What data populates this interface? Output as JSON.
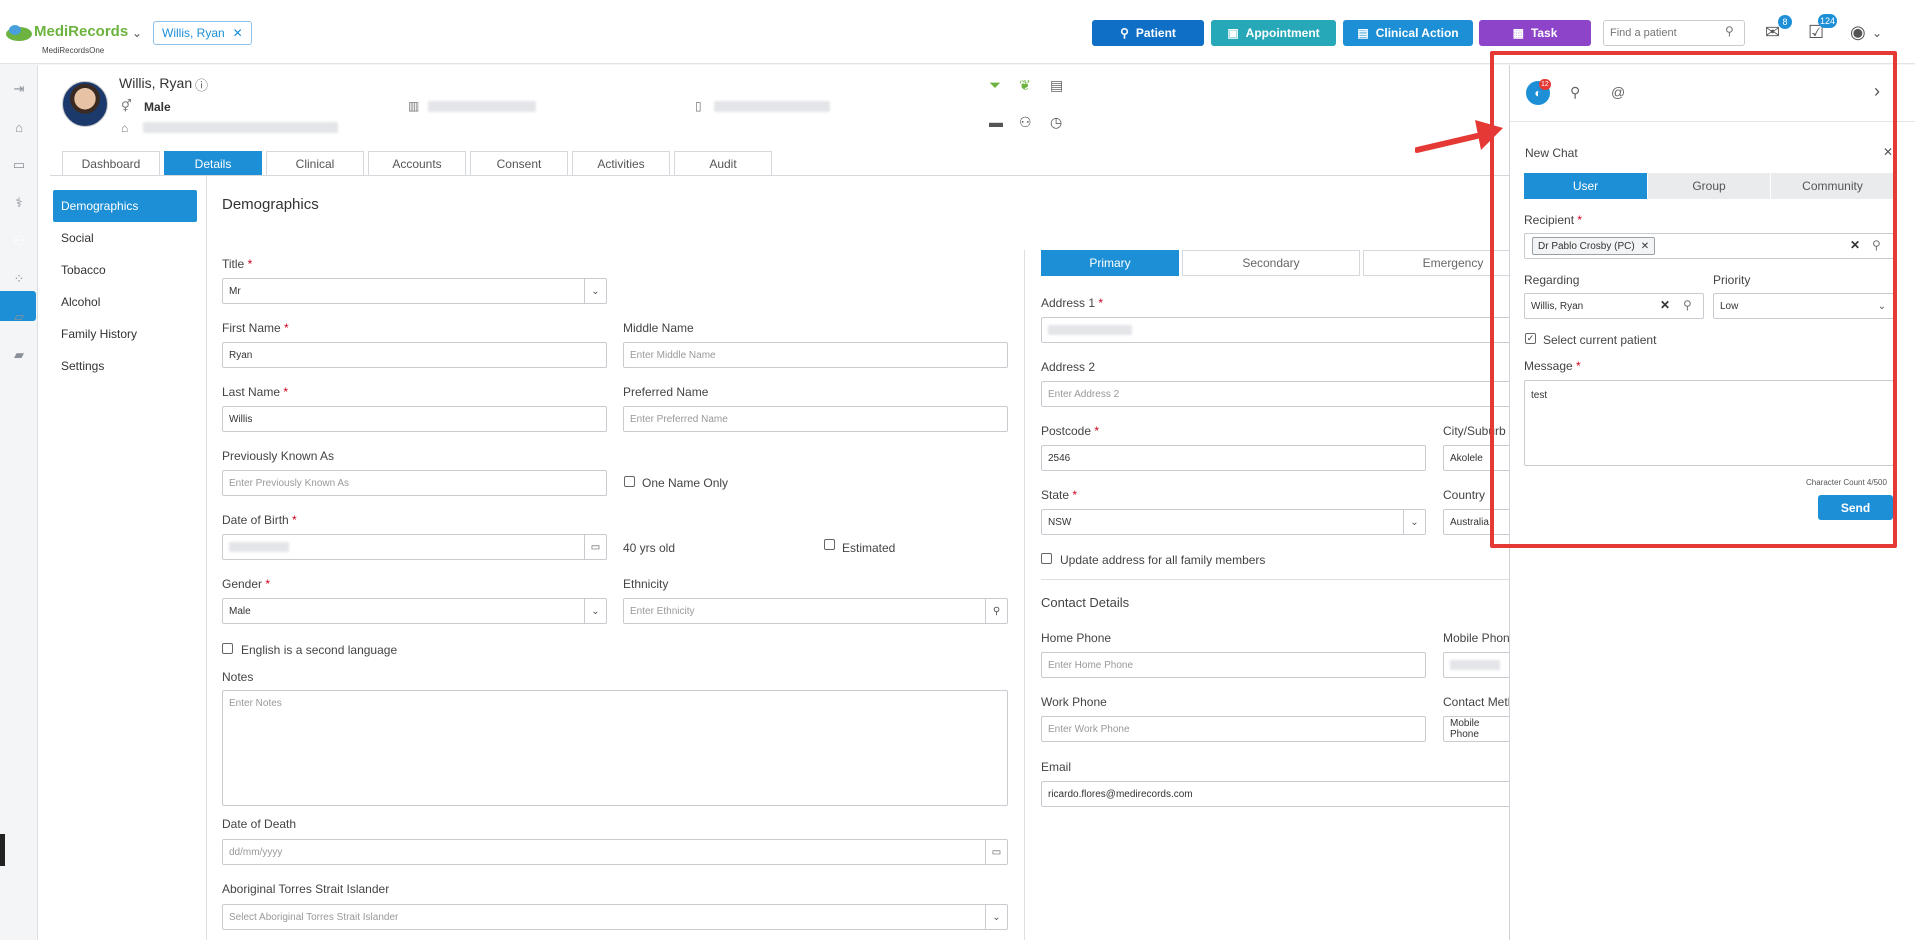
{
  "header": {
    "logo_name": "MediRecords",
    "logo_sub": "MediRecordsOne",
    "patient_chip": "Willis, Ryan",
    "buttons": {
      "patient": "Patient",
      "appointment": "Appointment",
      "clinical_action": "Clinical Action",
      "task": "Task"
    },
    "search_placeholder": "Find a patient",
    "mail_badge": "8",
    "tasks_badge": "124",
    "colors": {
      "patient": "#0f6fc6",
      "appointment": "#26a8b8",
      "clinical_action": "#1d8fd6",
      "task": "#8e44c8"
    }
  },
  "patient": {
    "name": "Willis, Ryan",
    "gender": "Male"
  },
  "tabs": [
    "Dashboard",
    "Details",
    "Clinical",
    "Accounts",
    "Consent",
    "Activities",
    "Audit"
  ],
  "sidenav": [
    "Demographics",
    "Social",
    "Tobacco",
    "Alcohol",
    "Family History",
    "Settings"
  ],
  "form": {
    "section_title": "Demographics",
    "title_label": "Title",
    "title_value": "Mr",
    "first_name_label": "First Name",
    "first_name_value": "Ryan",
    "middle_name_label": "Middle Name",
    "middle_name_ph": "Enter Middle Name",
    "last_name_label": "Last Name",
    "last_name_value": "Willis",
    "preferred_name_label": "Preferred Name",
    "preferred_name_ph": "Enter Preferred Name",
    "prev_known_label": "Previously Known As",
    "prev_known_ph": "Enter Previously Known As",
    "one_name_label": "One Name Only",
    "dob_label": "Date of Birth",
    "age_text": "40 yrs old",
    "estimated_label": "Estimated",
    "gender_label": "Gender",
    "gender_value": "Male",
    "ethnicity_label": "Ethnicity",
    "ethnicity_ph": "Enter Ethnicity",
    "english_second_label": "English is a second language",
    "notes_label": "Notes",
    "notes_ph": "Enter Notes",
    "dod_label": "Date of Death",
    "dod_ph": "dd/mm/yyyy",
    "atsi_label": "Aboriginal Torres Strait Islander",
    "atsi_ph": "Select Aboriginal Torres Strait Islander"
  },
  "address": {
    "tabs": [
      "Primary",
      "Secondary",
      "Emergency"
    ],
    "address1_label": "Address 1",
    "address2_label": "Address 2",
    "address2_ph": "Enter Address 2",
    "postcode_label": "Postcode",
    "postcode_value": "2546",
    "city_label": "City/Suburb",
    "city_value": "Akolele",
    "state_label": "State",
    "state_value": "NSW",
    "country_label": "Country",
    "country_value": "Australia",
    "update_family_label": "Update address for all family members",
    "contact_title": "Contact Details",
    "home_phone_label": "Home Phone",
    "home_phone_ph": "Enter Home Phone",
    "mobile_label": "Mobile Phone",
    "work_phone_label": "Work Phone",
    "work_phone_ph": "Enter Work Phone",
    "contact_method_label": "Contact Method",
    "contact_method_value": "Mobile Phone",
    "email_label": "Email",
    "email_value": "ricardo.flores@medirecords.com"
  },
  "chat": {
    "chat_badge": "12",
    "title": "New Chat",
    "segments": [
      "User",
      "Group",
      "Community"
    ],
    "recipient_label": "Recipient",
    "recipient_chip": "Dr Pablo Crosby (PC)",
    "regarding_label": "Regarding",
    "regarding_value": "Willis, Ryan",
    "priority_label": "Priority",
    "priority_value": "Low",
    "select_current_label": "Select current patient",
    "message_label": "Message",
    "message_value": "test",
    "char_count": "Character Count 4/500",
    "send_label": "Send"
  }
}
